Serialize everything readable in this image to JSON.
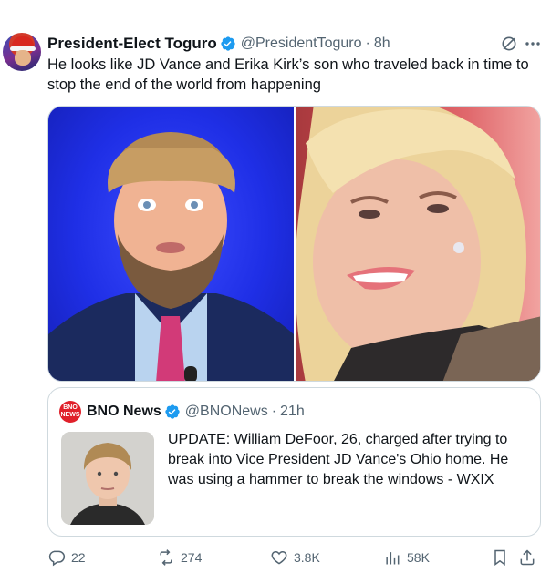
{
  "tweet": {
    "author": {
      "display_name": "President-Elect Toguro",
      "handle": "@PresidentToguro",
      "separator": "·",
      "time": "8h",
      "verified": true
    },
    "text": "He looks like JD Vance and Erika Kirk’s son who traveled back in time to stop the end of the world from happening",
    "media": [
      {
        "description_icon": "photo-man"
      },
      {
        "description_icon": "photo-woman"
      }
    ],
    "quoted": {
      "avatar_text": "BNO NEWS",
      "display_name": "BNO News",
      "handle": "@BNONews",
      "separator": "·",
      "time": "21h",
      "verified": true,
      "text": "UPDATE: William DeFoor, 26, charged after trying to break into Vice President JD Vance's Ohio home. He was using a hammer to break the windows - WXIX"
    },
    "actions": {
      "replies": "22",
      "reposts": "274",
      "likes": "3.8K",
      "views": "58K"
    }
  },
  "colors": {
    "verified": "#1d9bf0",
    "text": "#0f1419",
    "secondary": "#536471",
    "border": "#cfd9de"
  }
}
